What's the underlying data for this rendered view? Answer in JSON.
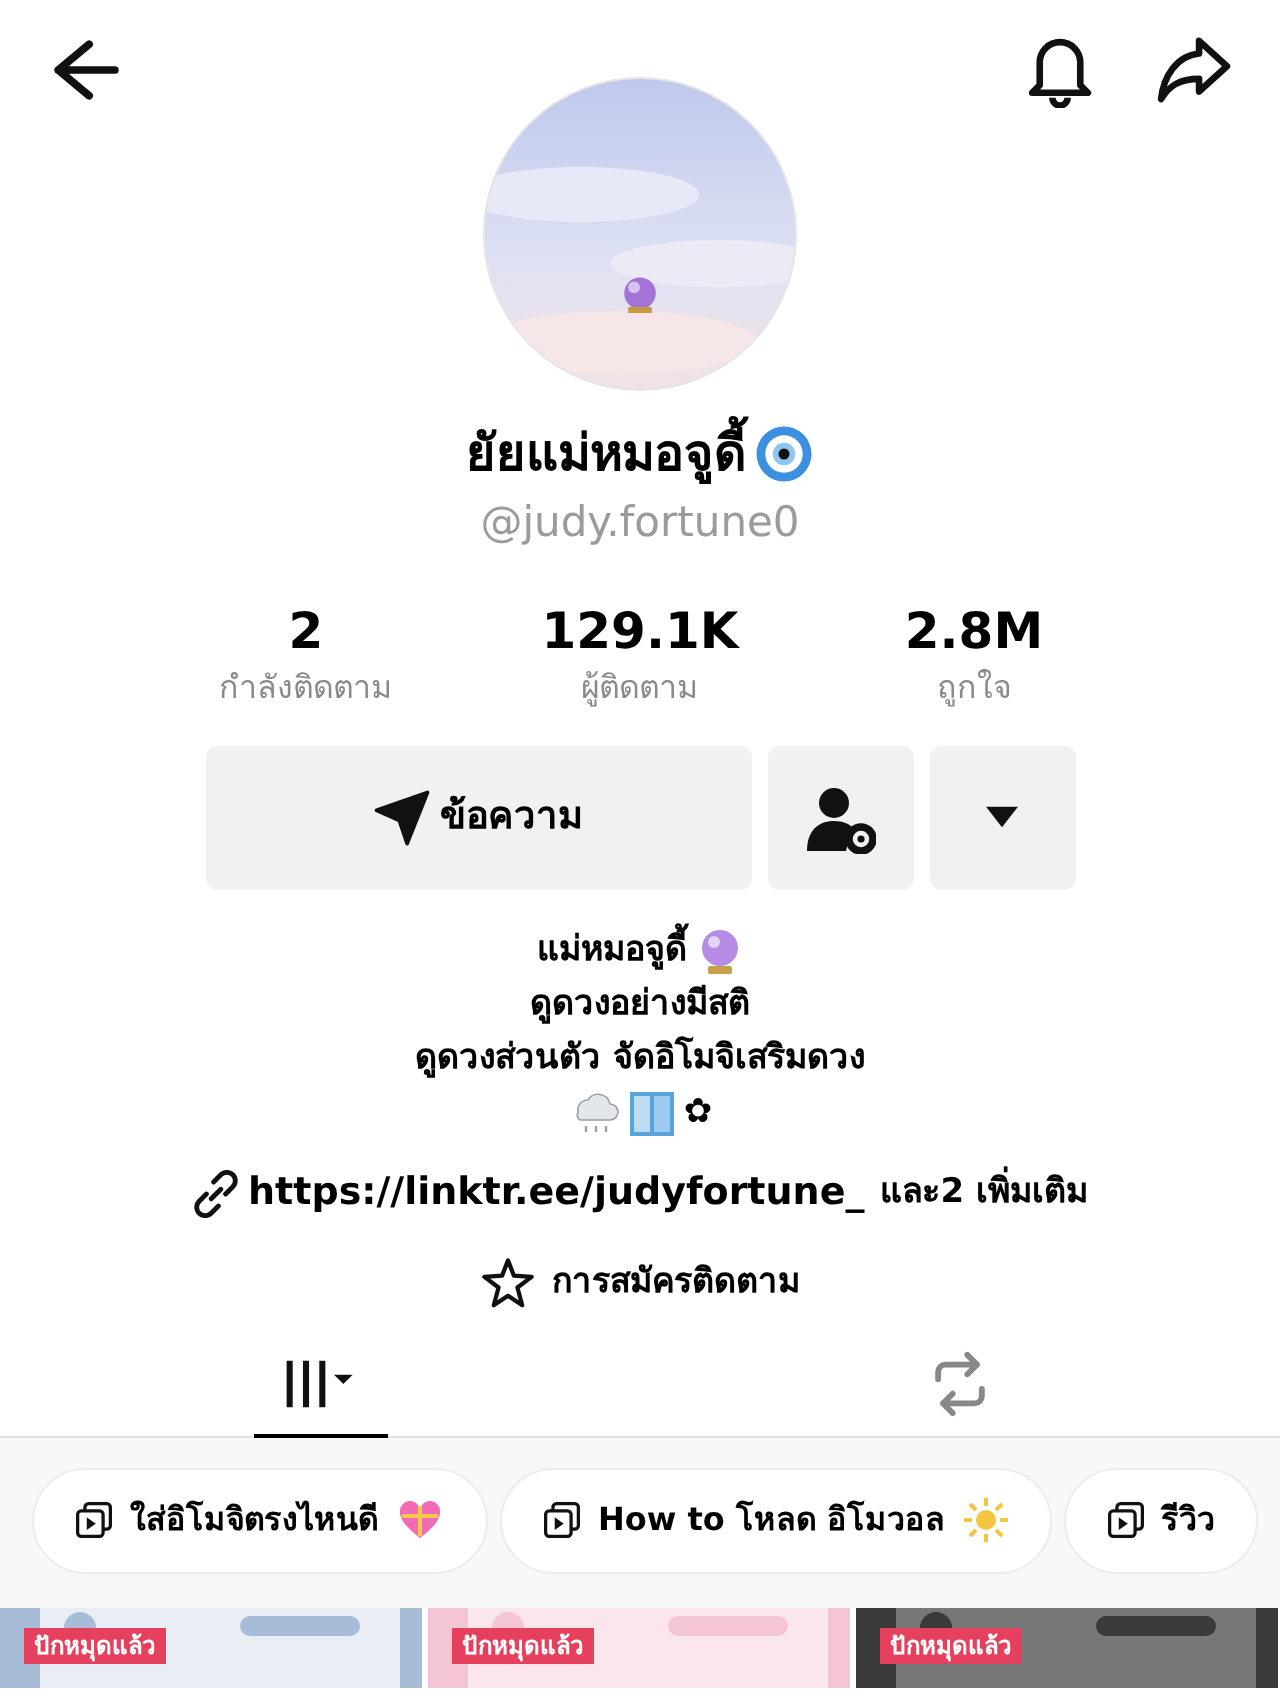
{
  "profile": {
    "name": "ยัยแม่หมอจูดี้",
    "handle": "@judy.fortune0"
  },
  "stats": [
    {
      "value": "2",
      "label": "กำลังติดตาม"
    },
    {
      "value": "129.1K",
      "label": "ผู้ติดตาม"
    },
    {
      "value": "2.8M",
      "label": "ถูกใจ"
    }
  ],
  "message_button": "ข้อความ",
  "bio": [
    "แม่หมอจูดี้",
    "ดูดวงอย่างมีสติ",
    "ดูดวงส่วนตัว จัดอิโมจิเสริมดวง",
    "✿"
  ],
  "link": {
    "url": "https://linktr.ee/judyfortune_",
    "more": "และ2 เพิ่มเติม"
  },
  "subscription": "การสมัครติดตาม",
  "tabs": [
    {
      "kind": "grid",
      "selected": true
    },
    {
      "kind": "repost",
      "selected": false
    }
  ],
  "playlists": [
    "ใส่อิโมจิตรงไหนดี",
    "How to โหลด อิโมวอล",
    "รีวิว"
  ],
  "videos": [
    {
      "badge": "ปักหมุดแล้ว"
    },
    {
      "badge": "ปักหมุดแล้ว"
    },
    {
      "badge": "ปักหมุดแล้ว"
    }
  ]
}
